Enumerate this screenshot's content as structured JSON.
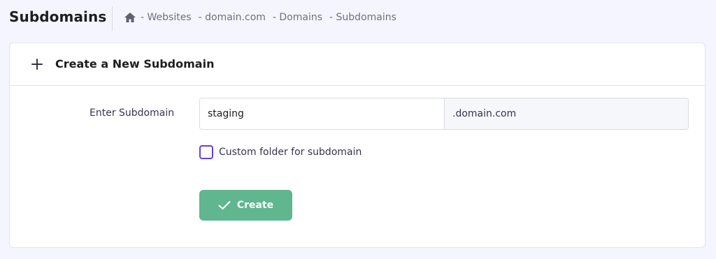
{
  "header": {
    "title": "Subdomains",
    "breadcrumb": [
      {
        "label": "- Websites"
      },
      {
        "label": "- domain.com"
      },
      {
        "label": "- Domains"
      },
      {
        "label": "- Subdomains"
      }
    ],
    "home_icon": "home-icon"
  },
  "card": {
    "title": "Create a New Subdomain",
    "header_icon": "plus-icon",
    "form": {
      "subdomain_label": "Enter Subdomain",
      "subdomain_value": "staging",
      "domain_suffix": ".domain.com",
      "custom_folder_label": "Custom folder for subdomain",
      "custom_folder_checked": false
    },
    "create_button": {
      "label": "Create",
      "icon": "check-icon"
    }
  },
  "colors": {
    "page_background": "#f4f5ff",
    "checkbox_border": "#673de6",
    "create_button_background": "#5fb68f"
  }
}
